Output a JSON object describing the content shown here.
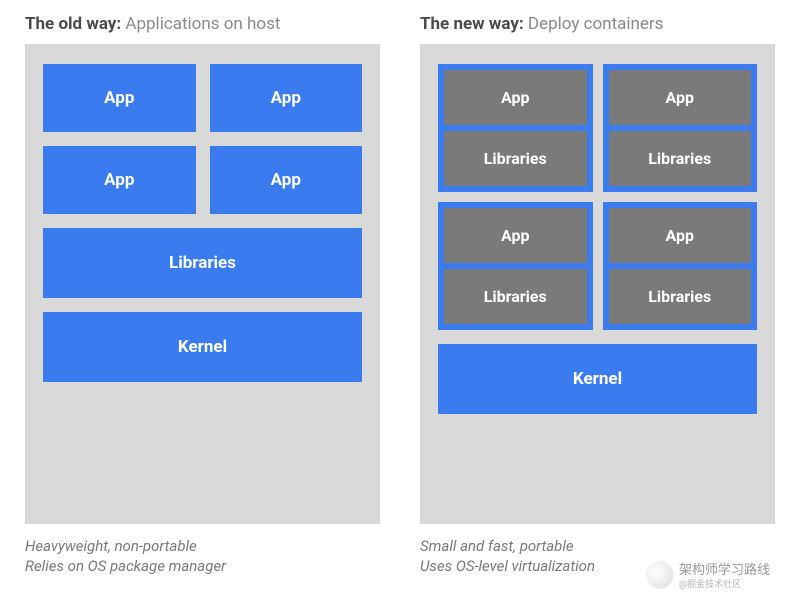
{
  "old": {
    "title_bold": "The old way:",
    "title_rest": " Applications on host",
    "apps_row1": [
      "App",
      "App"
    ],
    "apps_row2": [
      "App",
      "App"
    ],
    "libraries": "Libraries",
    "kernel": "Kernel",
    "footer_line1": "Heavyweight, non-portable",
    "footer_line2": "Relies on OS package manager"
  },
  "new": {
    "title_bold": "The new way:",
    "title_rest": " Deploy containers",
    "pods": [
      {
        "app": "App",
        "lib": "Libraries"
      },
      {
        "app": "App",
        "lib": "Libraries"
      },
      {
        "app": "App",
        "lib": "Libraries"
      },
      {
        "app": "App",
        "lib": "Libraries"
      }
    ],
    "kernel": "Kernel",
    "footer_line1": "Small and fast, portable",
    "footer_line2": "Uses OS-level virtualization"
  },
  "watermark": {
    "main": "架构师学习路线",
    "sub": "@掘金技术社区"
  }
}
